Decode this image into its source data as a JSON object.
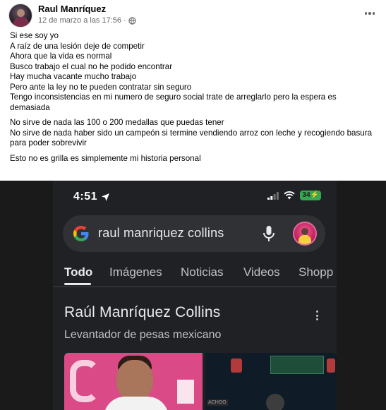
{
  "post": {
    "author": "Raul Manríquez",
    "timestamp": "12 de marzo a las 17:56",
    "separator": "·",
    "audience_icon": "globe-icon",
    "more_icon": "more-options-icon",
    "lines_block1": [
      "Si ese soy yo",
      "A raíz de una lesión deje de competir",
      "Ahora que la vida es normal",
      "Busco trabajo el cual no he podido encontrar",
      "Hay mucha vacante mucho trabajo",
      "Pero ante la ley no te pueden contratar sin seguro",
      "Tengo inconsistencias en mi numero de seguro social trate de arreglarlo pero la espera es demasiada"
    ],
    "lines_block2": [
      "No sirve de nada las 100 o 200 medallas que puedas tener",
      "No sirve de nada haber sido un campeón si termine vendiendo arroz con leche y recogiendo basura para poder sobrevivir"
    ],
    "lines_block3": [
      "Esto no es grilla es simplemente mi historia personal"
    ]
  },
  "screenshot": {
    "status_time": "4:51",
    "battery": "34",
    "search_query": "raul manriquez collins",
    "tabs": [
      "Todo",
      "Imágenes",
      "Noticias",
      "Videos",
      "Shopp"
    ],
    "active_tab": "Todo",
    "kp_title": "Raúl Manríquez Collins",
    "kp_subtitle": "Levantador de pesas mexicano",
    "image_tag": "ACHOO",
    "colors": {
      "background": "#202124",
      "search_bar": "#303134",
      "text_primary": "#e8eaed",
      "text_secondary": "#bdc1c6",
      "battery": "#34a853"
    }
  }
}
